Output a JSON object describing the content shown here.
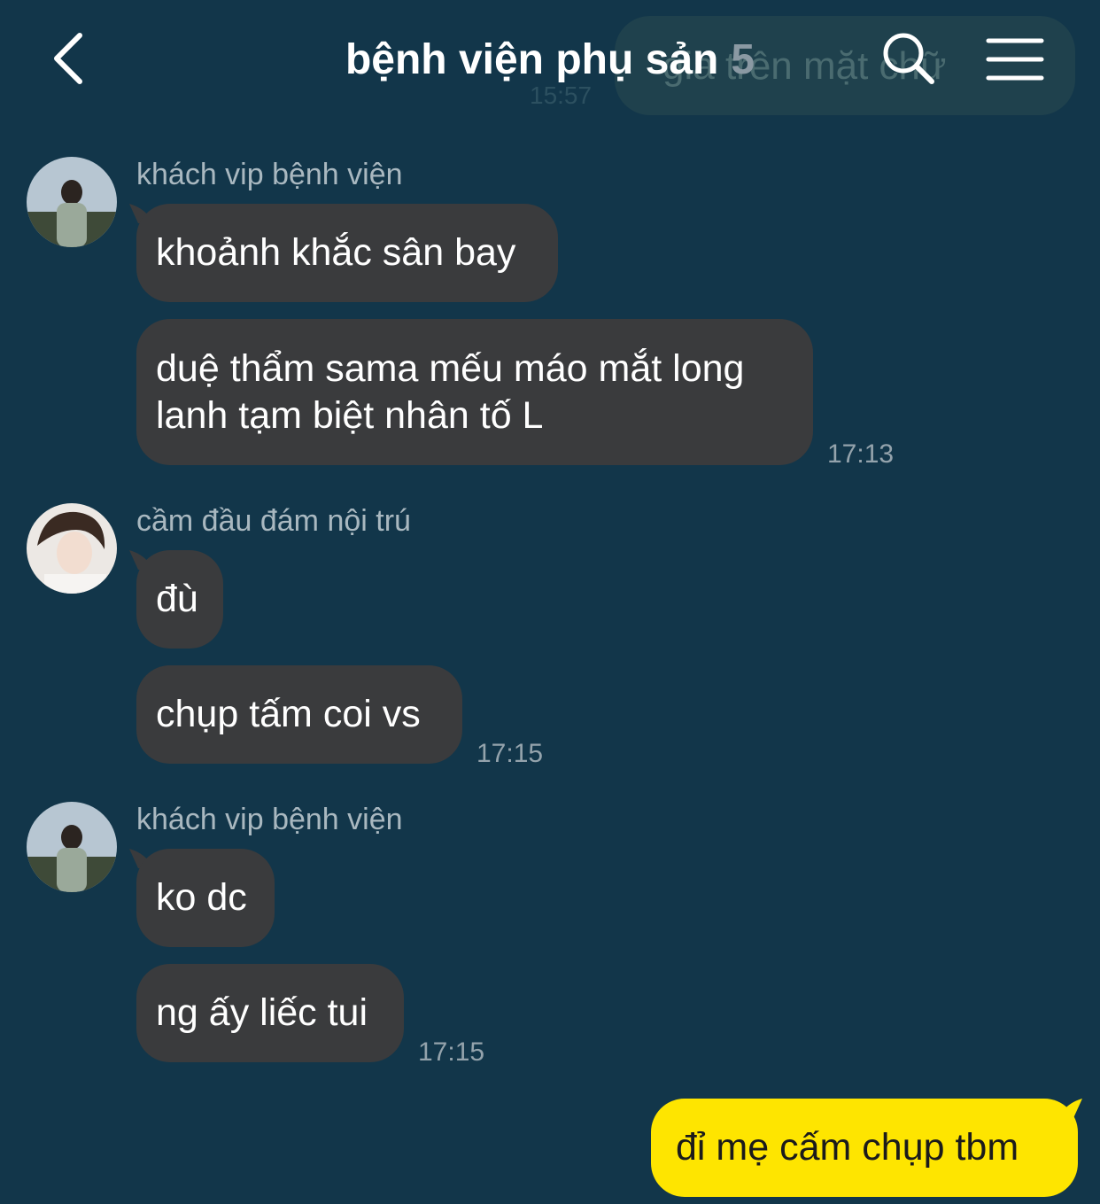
{
  "header": {
    "title": "bệnh viện phụ sản",
    "member_count": "5",
    "back_icon": "chevron-left-icon",
    "search_icon": "search-icon",
    "menu_icon": "hamburger-menu-icon"
  },
  "ghost": {
    "text": "gia trên mặt chữ",
    "time": "15:57"
  },
  "groups": [
    {
      "sender": "khách vip bệnh viện",
      "messages": [
        "khoảnh khắc sân bay",
        "duệ thẩm sama mếu máo mắt long lanh tạm biệt nhân tố L"
      ],
      "time": "17:13"
    },
    {
      "sender": "cầm đầu đám nội trú",
      "messages": [
        "đù",
        "chụp tấm coi vs"
      ],
      "time": "17:15"
    },
    {
      "sender": "khách vip bệnh viện",
      "messages": [
        "ko dc",
        "ng ấy liếc tui"
      ],
      "time": "17:15"
    }
  ],
  "my_message": {
    "text": "đỉ mẹ cấm chụp tbm"
  },
  "colors": {
    "background": "#12364a",
    "bubble": "#3a3b3d",
    "my_bubble": "#fee500"
  }
}
